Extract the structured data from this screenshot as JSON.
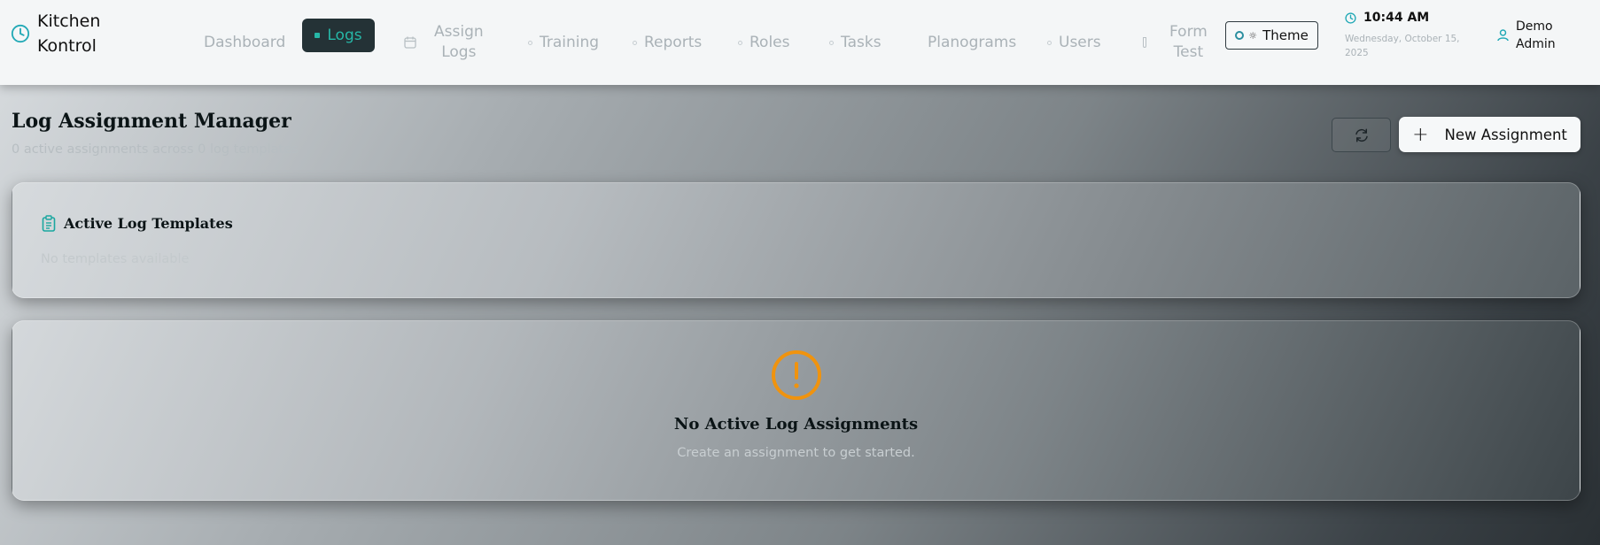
{
  "app": {
    "brand_line1": "Kitchen",
    "brand_line2": "Kontrol"
  },
  "nav": {
    "items": [
      {
        "label": "Dashboard"
      },
      {
        "label": "Logs",
        "active": true
      },
      {
        "label": "Assign\nLogs"
      },
      {
        "label": "Training"
      },
      {
        "label": "Reports"
      },
      {
        "label": "Roles"
      },
      {
        "label": "Tasks"
      },
      {
        "label": "Planograms"
      },
      {
        "label": "Users"
      },
      {
        "label": "Form\nTest"
      }
    ],
    "theme_label": "Theme"
  },
  "clock": {
    "time": "10:44 AM",
    "date": "Wednesday, October 15, 2025"
  },
  "user": {
    "line1": "Demo",
    "line2": "Admin"
  },
  "page": {
    "title": "Log Assignment Manager",
    "subtitle": "0 active assignments across 0 log templates",
    "new_button": "New Assignment"
  },
  "templates_card": {
    "title": "Active Log Templates",
    "empty_text": "No templates available"
  },
  "assignments_card": {
    "empty_title": "No Active Log Assignments",
    "empty_sub": "Create an assignment to get started."
  },
  "colors": {
    "accent": "#26b7a7",
    "warning": "#f0930e",
    "active_nav_bg": "#243236"
  },
  "icons": {
    "brand": "clock-icon",
    "refresh": "refresh-icon",
    "alert": "alert-circle-icon",
    "clipboard": "clipboard-icon",
    "user": "user-icon"
  }
}
